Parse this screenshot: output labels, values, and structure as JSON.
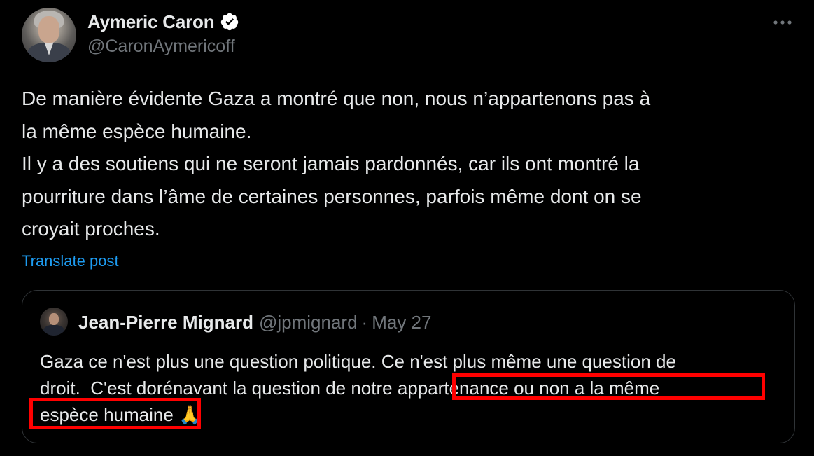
{
  "author": {
    "display_name": "Aymeric Caron",
    "handle": "@CaronAymericoff",
    "verified_icon": "verified-badge-icon",
    "more_icon": "more-options-icon"
  },
  "tweet": {
    "line1": "De manière évidente Gaza a montré que non, nous n’appartenons pas à",
    "line2": "la même espèce humaine.",
    "line3": "Il y a des soutiens qui ne seront jamais pardonnés, car ils ont montré la",
    "line4": "pourriture dans l’âme de certaines personnes, parfois même dont on se",
    "line5": "croyait proches.",
    "translate_label": "Translate post"
  },
  "quote": {
    "display_name": "Jean-Pierre Mignard",
    "handle": "@jpmignard",
    "separator": "·",
    "date": "May 27",
    "text_line1": "Gaza ce n'est plus une question politique. Ce n'est plus même une question de",
    "text_line2_prefix": "droit.  C'est dorénavant la question de notre ",
    "text_line2_highlight": "appartenance ou non a la même",
    "text_line3_highlight": "espèce humaine",
    "text_line3_suffix": " ",
    "emoji": "🙏"
  },
  "colors": {
    "background": "#000000",
    "text_primary": "#e7e9ea",
    "text_secondary": "#71767b",
    "link": "#1d9bf0",
    "verified_badge": "#ffffff",
    "highlight_box": "#ff0000",
    "quote_border": "#2f3336"
  }
}
